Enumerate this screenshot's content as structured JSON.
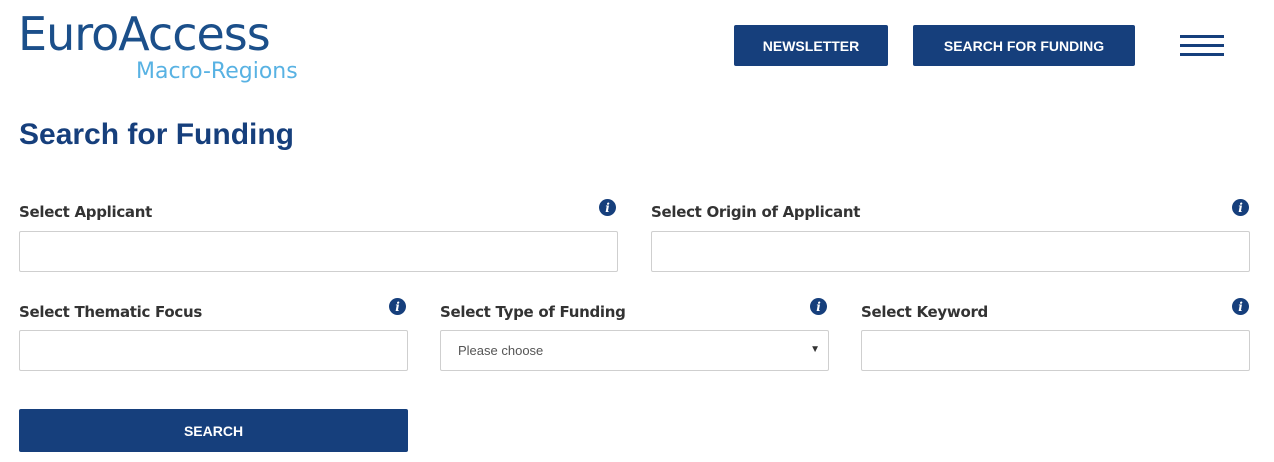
{
  "logo": {
    "main": "EuroAccess",
    "sub": "Macro-Regions"
  },
  "header": {
    "newsletter_label": "NEWSLETTER",
    "search_funding_label": "SEARCH FOR FUNDING",
    "menu_icon": "hamburger-menu-icon"
  },
  "page": {
    "title": "Search for Funding"
  },
  "form": {
    "applicant": {
      "label": "Select Applicant",
      "value": "",
      "info_icon": "info-icon"
    },
    "origin": {
      "label": "Select Origin of Applicant",
      "value": "",
      "info_icon": "info-icon"
    },
    "thematic": {
      "label": "Select Thematic Focus",
      "value": "",
      "info_icon": "info-icon"
    },
    "funding_type": {
      "label": "Select Type of Funding",
      "selected": "Please choose",
      "info_icon": "info-icon"
    },
    "keyword": {
      "label": "Select Keyword",
      "value": "",
      "info_icon": "info-icon"
    },
    "search_label": "SEARCH"
  },
  "colors": {
    "primary": "#163f7c",
    "logo_blue": "#1b4f8a",
    "logo_light": "#58b2e3"
  }
}
